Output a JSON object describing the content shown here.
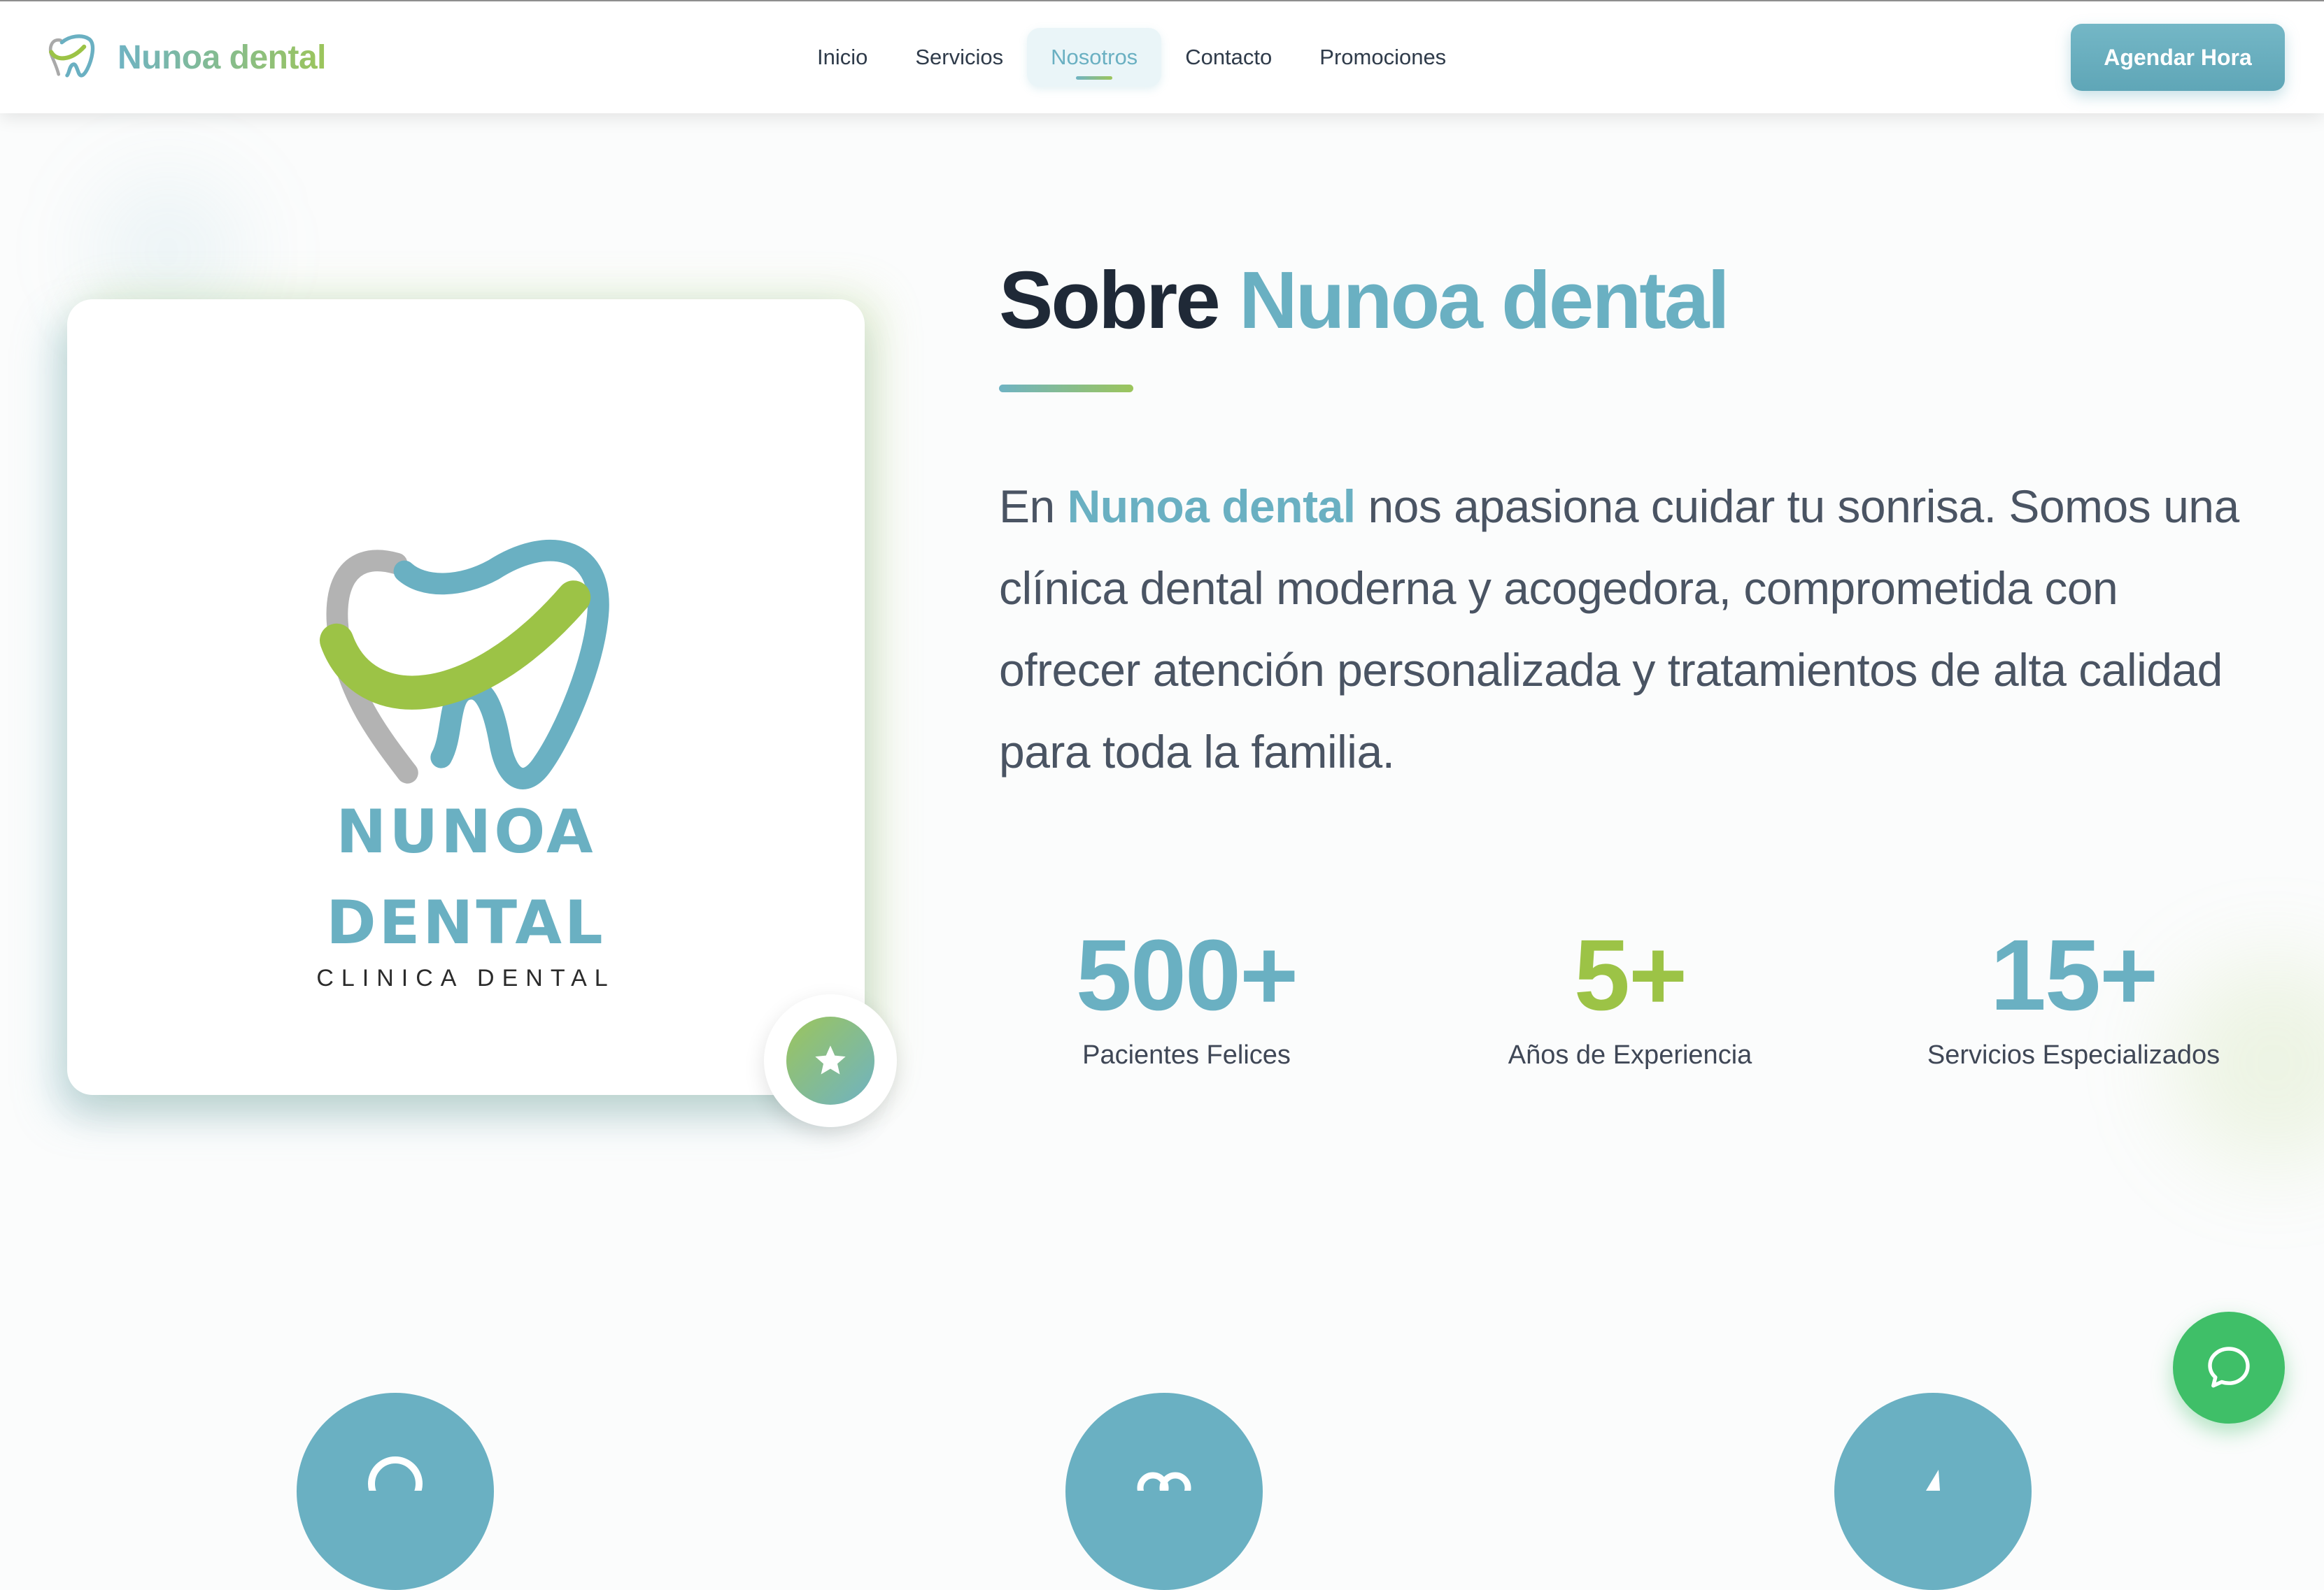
{
  "nav": {
    "brand": "Nunoa dental",
    "links": [
      {
        "label": "Inicio"
      },
      {
        "label": "Servicios"
      },
      {
        "label": "Nosotros",
        "active": true
      },
      {
        "label": "Contacto"
      },
      {
        "label": "Promociones"
      }
    ],
    "cta_label": "Agendar Hora"
  },
  "logo_card": {
    "line1": "NUNOA",
    "line2": "DENTAL",
    "subtitle": "CLINICA DENTAL",
    "badge_icon": "star-icon"
  },
  "about": {
    "title_prefix": "Sobre",
    "title_accent": "Nunoa dental",
    "body_prefix": "En",
    "body_brand": "Nunoa dental",
    "body_rest": "nos apasiona cuidar tu sonrisa. Somos una clínica dental moderna y acogedora, comprometida con ofrecer atención personalizada y tratamientos de alta calidad para toda la familia."
  },
  "stats": [
    {
      "value": "500+",
      "label": "Pacientes Felices"
    },
    {
      "value": "5+",
      "label": "Años de Experiencia"
    },
    {
      "value": "15+",
      "label": "Servicios Especializados"
    }
  ],
  "colors": {
    "primary": "#6ab0c2",
    "secondary": "#9cc346",
    "heading": "#1f2937",
    "whatsapp": "#3fbf68"
  },
  "chat": {
    "icon": "chat-bubble-icon"
  }
}
